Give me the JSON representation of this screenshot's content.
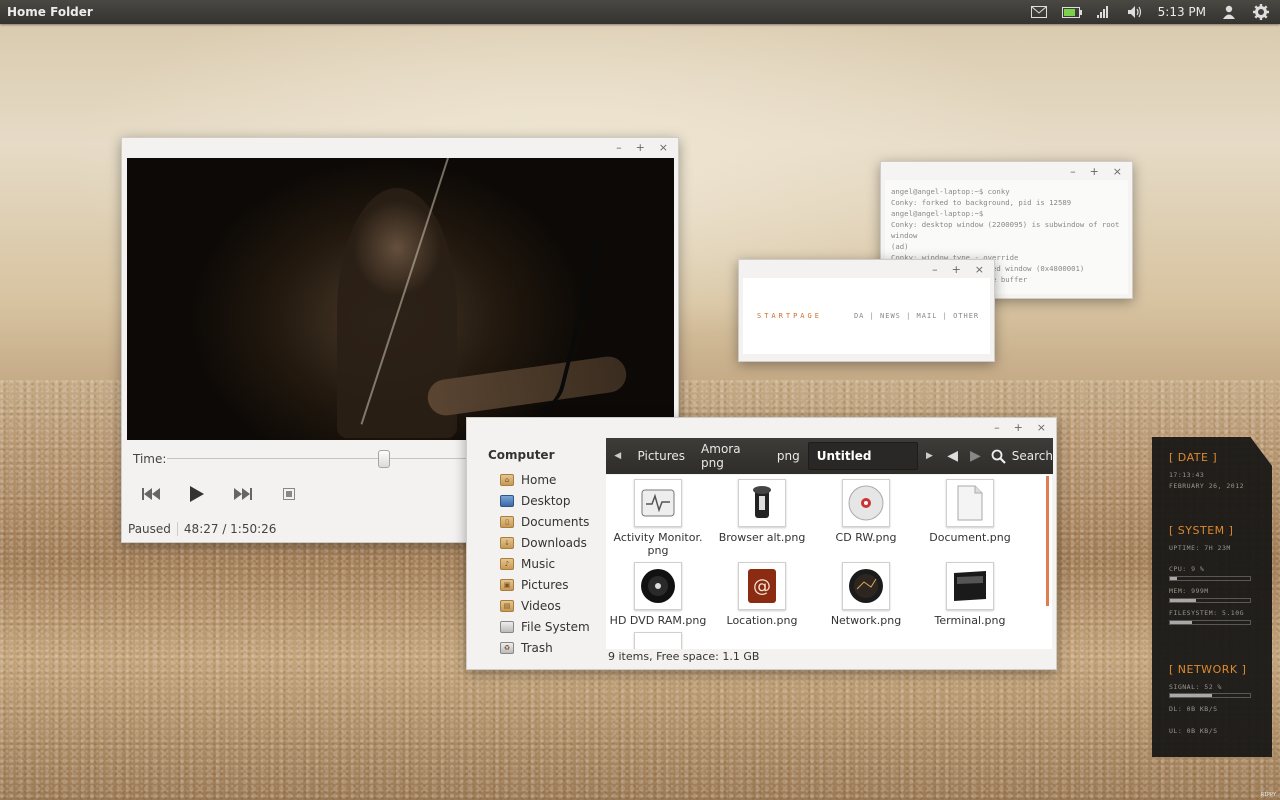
{
  "panel": {
    "app_title": "Home Folder",
    "clock": "5:13 PM",
    "battery_level": 0.85,
    "icons": [
      "mail-icon",
      "battery-icon",
      "signal-icon",
      "volume-icon",
      "user-icon",
      "gear-icon"
    ]
  },
  "player": {
    "controls": {
      "minimize": "–",
      "maximize": "+",
      "close": "×"
    },
    "time_label": "Time:",
    "seek_fraction": 0.44,
    "state": "Paused",
    "position": "48:27 / 1:50:26"
  },
  "terminal": {
    "lines": [
      "angel@angel-laptop:~$ conky",
      "Conky: forked to background, pid is 12589",
      "angel@angel-laptop:~$",
      "Conky: desktop window (2200095) is subwindow of root window",
      "(ad)",
      "Conky: window type - override",
      "Conky: drawing to created window (0x4800001)",
      "Conky: drawing to double buffer"
    ]
  },
  "startpage": {
    "brand": "STARTPAGE",
    "links": [
      "DA",
      "NEWS",
      "MAIL",
      "OTHER"
    ]
  },
  "file_manager": {
    "sidebar": {
      "header": "Computer",
      "items": [
        {
          "label": "Home",
          "icon": "home-icon",
          "mark": "⌂"
        },
        {
          "label": "Desktop",
          "icon": "desktop-icon",
          "mark": ""
        },
        {
          "label": "Documents",
          "icon": "documents-folder-icon",
          "mark": "▯"
        },
        {
          "label": "Downloads",
          "icon": "downloads-folder-icon",
          "mark": "↓"
        },
        {
          "label": "Music",
          "icon": "music-folder-icon",
          "mark": "♪"
        },
        {
          "label": "Pictures",
          "icon": "pictures-folder-icon",
          "mark": "▣"
        },
        {
          "label": "Videos",
          "icon": "videos-folder-icon",
          "mark": "▤"
        },
        {
          "label": "File System",
          "icon": "filesystem-icon",
          "mark": ""
        },
        {
          "label": "Trash",
          "icon": "trash-icon",
          "mark": "♻"
        }
      ]
    },
    "breadcrumbs": [
      "Pictures",
      "Amora png",
      "png",
      "Untitled Folder"
    ],
    "search_label": "Search",
    "files": [
      {
        "name": "Activity Monitor.\npng",
        "icon": "activity-monitor-icon"
      },
      {
        "name": "Browser alt.png",
        "icon": "browser-icon"
      },
      {
        "name": "CD RW.png",
        "icon": "cd-icon"
      },
      {
        "name": "Document.png",
        "icon": "document-icon"
      },
      {
        "name": "HD DVD RAM.png",
        "icon": "dvd-icon"
      },
      {
        "name": "Location.png",
        "icon": "location-icon"
      },
      {
        "name": "Network.png",
        "icon": "network-icon"
      },
      {
        "name": "Terminal.png",
        "icon": "terminal-icon"
      }
    ],
    "status": "9 items, Free space: 1.1 GB"
  },
  "conky": {
    "date_head": "[ DATE ]",
    "time": "17:13:43",
    "date": "FEBRUARY 26, 2012",
    "system_head": "[ SYSTEM ]",
    "uptime": "UPTIME: 7H 23M",
    "cpu": "CPU: 9 %",
    "cpu_fraction": 0.09,
    "mem": "MEM: 999M",
    "mem_fraction": 0.32,
    "fs": "FILESYSTEM: 5.10G",
    "fs_fraction": 0.28,
    "network_head": "[ NETWORK ]",
    "signal": "SIGNAL: 52 %",
    "signal_fraction": 0.52,
    "dl": "DL: 0B   KB/S",
    "ul": "UL: 0B   KB/S"
  },
  "watermark": "RIPPY"
}
